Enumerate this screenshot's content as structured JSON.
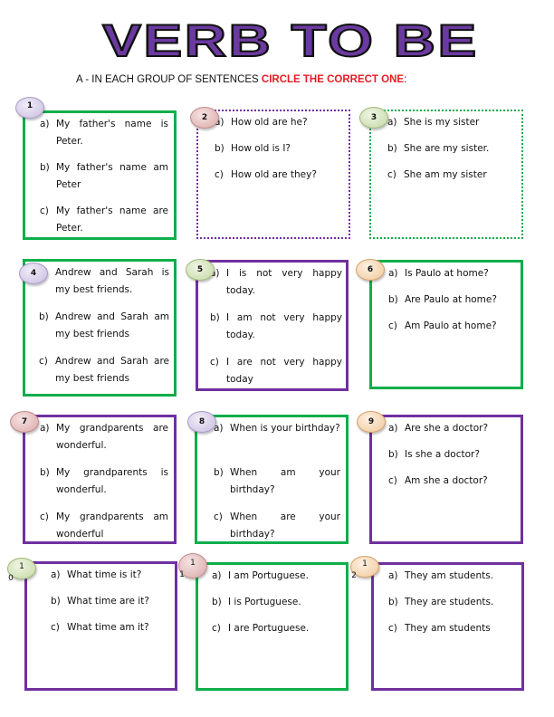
{
  "title": "VERB TO BE",
  "instruction": {
    "prefix": "A - IN EACH GROUP OF SENTENCES ",
    "highlight": "CIRCLE THE CORRECT ONE",
    "suffix": ":"
  },
  "colors": {
    "title_fill": "#6b3aa0",
    "highlight": "#e51c23",
    "green_border": "#0fae4b",
    "purple_border": "#7030a0"
  },
  "groups": [
    {
      "number": "1",
      "options": [
        {
          "label": "a)",
          "text": "My father's name is Peter."
        },
        {
          "label": "b)",
          "text": "My father's name am Peter"
        },
        {
          "label": "c)",
          "text": "My father's name are Peter."
        }
      ]
    },
    {
      "number": "2",
      "options": [
        {
          "label": "a)",
          "text": "How old are he?"
        },
        {
          "label": "b)",
          "text": "How old is I?"
        },
        {
          "label": "c)",
          "text": "How old are they?"
        }
      ]
    },
    {
      "number": "3",
      "options": [
        {
          "label": "a)",
          "text": "She is my sister"
        },
        {
          "label": "b)",
          "text": "She are my sister."
        },
        {
          "label": "c)",
          "text": "She am my sister"
        }
      ]
    },
    {
      "number": "4",
      "options": [
        {
          "label": "a)",
          "text": "Andrew and Sarah is my best friends."
        },
        {
          "label": "b)",
          "text": "Andrew and Sarah am my best friends"
        },
        {
          "label": "c)",
          "text": "Andrew and Sarah are my best friends"
        }
      ]
    },
    {
      "number": "5",
      "options": [
        {
          "label": "a)",
          "text": "I is not very happy today."
        },
        {
          "label": "b)",
          "text": "I am not very happy today."
        },
        {
          "label": "c)",
          "text": "I are not very happy today"
        }
      ]
    },
    {
      "number": "6",
      "options": [
        {
          "label": "a)",
          "text": "Is Paulo at home?"
        },
        {
          "label": "b)",
          "text": "Are Paulo at home?"
        },
        {
          "label": "c)",
          "text": "Am Paulo at home?"
        }
      ]
    },
    {
      "number": "7",
      "options": [
        {
          "label": "a)",
          "text": "My grandparents are wonderful."
        },
        {
          "label": "b)",
          "text": "My grandparents is wonderful."
        },
        {
          "label": "c)",
          "text": "My grandparents am wonderful"
        }
      ]
    },
    {
      "number": "8",
      "options": [
        {
          "label": "a)",
          "text": "When is your birthday?"
        },
        {
          "label": "b)",
          "text": "When am your birthday?"
        },
        {
          "label": "c)",
          "text": "When are your birthday?"
        }
      ]
    },
    {
      "number": "9",
      "options": [
        {
          "label": "a)",
          "text": "Are she a doctor?"
        },
        {
          "label": "b)",
          "text": "Is she a doctor?"
        },
        {
          "label": "c)",
          "text": "Am she a doctor?"
        }
      ]
    },
    {
      "number": "10",
      "number_top": "1",
      "number_bottom": "0",
      "options": [
        {
          "label": "a)",
          "text": "What time is it?"
        },
        {
          "label": "b)",
          "text": "What time are it?"
        },
        {
          "label": "c)",
          "text": "What time am it?"
        }
      ]
    },
    {
      "number": "11",
      "number_top": "1",
      "number_bottom": "1",
      "options": [
        {
          "label": "a)",
          "text": "I am Portuguese."
        },
        {
          "label": "b)",
          "text": "I is Portuguese."
        },
        {
          "label": "c)",
          "text": "I are Portuguese."
        }
      ]
    },
    {
      "number": "12",
      "number_top": "1",
      "number_bottom": "2",
      "options": [
        {
          "label": "a)",
          "text": "They am students."
        },
        {
          "label": "b)",
          "text": "They are students."
        },
        {
          "label": "c)",
          "text": "They am students"
        }
      ]
    }
  ]
}
